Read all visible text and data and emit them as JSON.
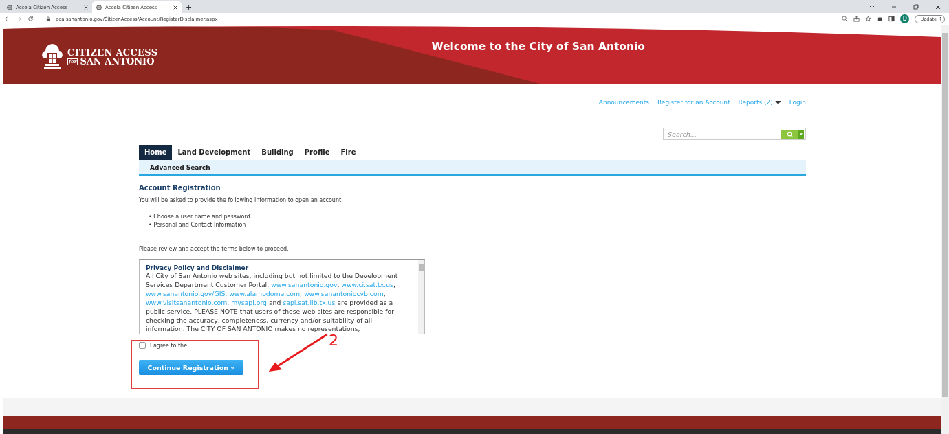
{
  "browser": {
    "tabs": [
      {
        "title": "Accela Citizen Access",
        "selected": false
      },
      {
        "title": "Accela Citizen Access",
        "selected": true
      }
    ],
    "new_tab": "+",
    "url": "aca.sanantonio.gov/CitizenAccess/Account/RegisterDisclaimer.aspx",
    "profile": "D",
    "update": "Update"
  },
  "header": {
    "logo_line1": "CITIZEN ACCESS",
    "logo_for": "for",
    "logo_line2": "SAN ANTONIO",
    "title": "Welcome to the City of San Antonio"
  },
  "top_links": [
    {
      "label": "Announcements",
      "kind": "link"
    },
    {
      "label": "Register for an Account",
      "kind": "link"
    },
    {
      "label": "Reports (2)",
      "kind": "menu"
    },
    {
      "label": "Login",
      "kind": "link"
    }
  ],
  "search": {
    "placeholder": "Search..."
  },
  "nav_tabs": [
    {
      "label": "Home",
      "selected": true
    },
    {
      "label": "Land Development",
      "selected": false
    },
    {
      "label": "Building",
      "selected": false
    },
    {
      "label": "Profile",
      "selected": false
    },
    {
      "label": "Fire",
      "selected": false
    }
  ],
  "sub_nav": [
    "Advanced Search"
  ],
  "section_title": "Account Registration",
  "intro": "You will be asked to provide the following information to open an account:",
  "bullets": [
    "• Choose a user name and password",
    "• Personal and Contact Information"
  ],
  "review_note": "Please review and accept the terms below to proceed.",
  "disclaimer": {
    "title": "Privacy Policy and Disclaimer",
    "segments": [
      {
        "kind": "text",
        "text": "All City of San Antonio web sites, including but not limited to the Development Services Department Customer Portal,  "
      },
      {
        "kind": "link",
        "text": "www.sanantonio.gov"
      },
      {
        "kind": "text",
        "text": ", "
      },
      {
        "kind": "link",
        "text": "www.ci.sat.tx.us"
      },
      {
        "kind": "text",
        "text": ", "
      },
      {
        "kind": "link",
        "text": "www.sanantonio.gov/GIS"
      },
      {
        "kind": "text",
        "text": ", "
      },
      {
        "kind": "link",
        "text": "www.alamodome.com"
      },
      {
        "kind": "text",
        "text": ", "
      },
      {
        "kind": "link",
        "text": "www.sanantoniocvb.com"
      },
      {
        "kind": "text",
        "text": ", "
      },
      {
        "kind": "link",
        "text": "www.visitsanantonio.com"
      },
      {
        "kind": "text",
        "text": ", "
      },
      {
        "kind": "link",
        "text": "mysapl.org"
      },
      {
        "kind": "text",
        "text": " and "
      },
      {
        "kind": "link",
        "text": "sapl.sat.lib.tx.us"
      },
      {
        "kind": "text",
        "text": " are provided as a public service. PLEASE NOTE that users of these web sites are responsible for checking the accuracy, completeness, currency and/or suitability of all information. The CITY OF SAN ANTONIO makes no representations,"
      }
    ]
  },
  "agree": {
    "label": "I agree to the",
    "checked": false
  },
  "continue_button": "Continue Registration »",
  "annotation": {
    "label": "2"
  }
}
